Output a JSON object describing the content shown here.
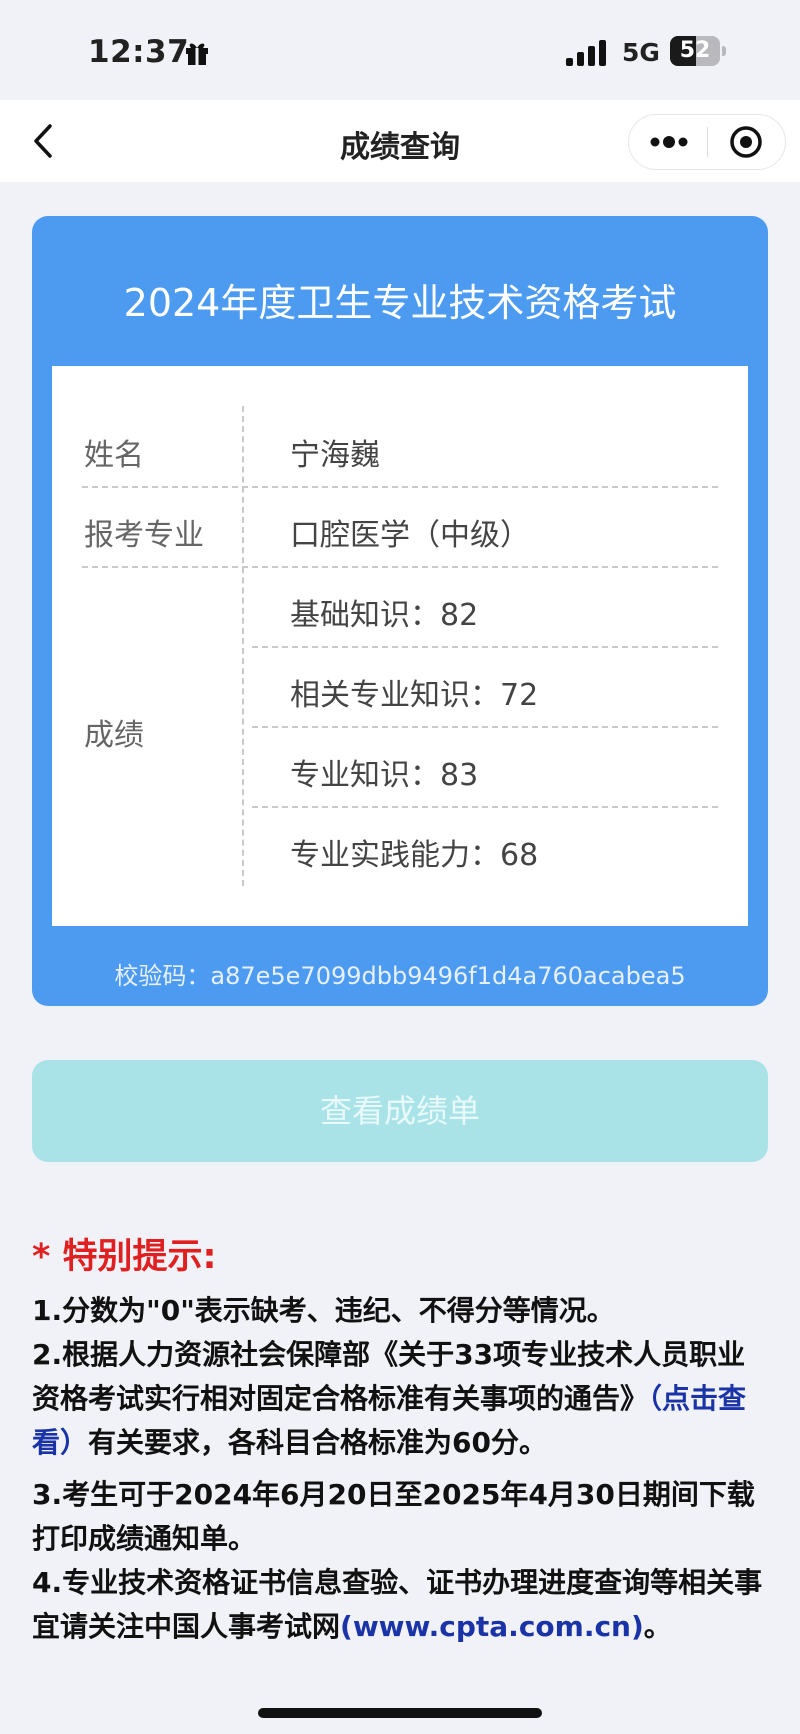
{
  "status_bar": {
    "time": "12:37",
    "network": "5G",
    "battery": "52"
  },
  "nav": {
    "title": "成绩查询"
  },
  "card": {
    "title": "2024年度卫生专业技术资格考试",
    "labels": {
      "name": "姓名",
      "major": "报考专业",
      "scores": "成绩"
    },
    "name": "宁海巍",
    "major": "口腔医学（中级）",
    "scores": [
      "基础知识：82",
      "相关专业知识：72",
      "专业知识：83",
      "专业实践能力：68"
    ],
    "checksum": "校验码：a87e5e7099dbb9496f1d4a760acabea5"
  },
  "view_button": {
    "label": "查看成绩单"
  },
  "notice": {
    "title": "* 特别提示:",
    "item1": "1.分数为\"0\"表示缺考、违纪、不得分等情况。",
    "item2_part1": "2.根据人力资源社会保障部《关于33项专业技术人员职业资格考试实行相对固定合格标准有关事项的通告》",
    "item2_link": "（点击查看）",
    "item2_part2": "有关要求，各科目合格标准为60分。",
    "item3": "3.考生可于2024年6月20日至2025年4月30日期间下载打印成绩通知单。",
    "item4_part1": "4.专业技术资格证书信息查验、证书办理进度查询等相关事宜请关注中国人事考试网",
    "item4_link": "(www.cpta.com.cn)",
    "item4_part2": "。"
  }
}
